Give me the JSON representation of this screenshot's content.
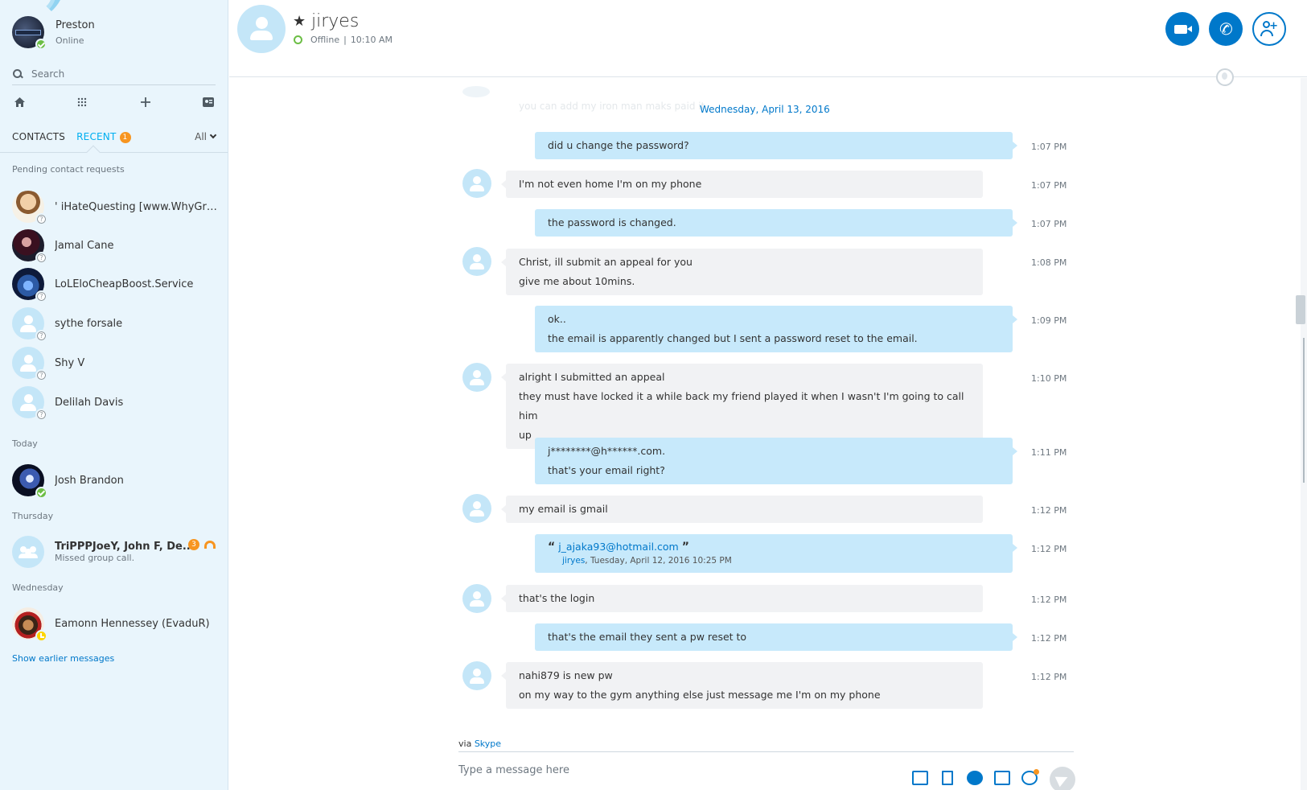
{
  "profile": {
    "name": "Preston",
    "status": "Online"
  },
  "search": {
    "placeholder": "Search"
  },
  "toolbar_icons": [
    "home-icon",
    "dialpad-icon",
    "plus-icon",
    "contacts-icon"
  ],
  "tabs": {
    "contacts": "CONTACTS",
    "recent": "RECENT",
    "recent_badge": "1",
    "filter": "All"
  },
  "sections": {
    "pending": "Pending contact requests",
    "today": "Today",
    "thursday": "Thursday",
    "wednesday": "Wednesday"
  },
  "pending_contacts": [
    {
      "name": "'    iHateQuesting [www.WhyGrin..."
    },
    {
      "name": "Jamal Cane"
    },
    {
      "name": "LoLEloCheapBoost.Service"
    },
    {
      "name": "sythe forsale"
    },
    {
      "name": "Shy V"
    },
    {
      "name": "Delilah Davis"
    }
  ],
  "today_contacts": [
    {
      "name": "Josh Brandon"
    }
  ],
  "thursday_contacts": [
    {
      "name": "TriPPPJoeY, John F, De...",
      "sub": "Missed group call.",
      "badge": "3"
    }
  ],
  "wednesday_contacts": [
    {
      "name": "Eamonn Hennessey (EvaduR)"
    }
  ],
  "show_earlier": "Show earlier messages",
  "conversation": {
    "name": "jiryes",
    "status": "Offline",
    "last_seen": "10:10 AM",
    "separator": "|"
  },
  "chat": {
    "faded_text": "you can add my iron man maks paid it",
    "date": "Wednesday, April 13, 2016",
    "messages": [
      {
        "from": "me",
        "lines": [
          "did u change the password?"
        ],
        "time": "1:07 PM"
      },
      {
        "from": "them",
        "lines": [
          "I'm not even home I'm on my phone"
        ],
        "time": "1:07 PM"
      },
      {
        "from": "me",
        "lines": [
          "the password is changed."
        ],
        "time": "1:07 PM"
      },
      {
        "from": "them",
        "lines": [
          "Christ, ill submit an appeal for you",
          "give me about 10mins."
        ],
        "time": "1:08 PM"
      },
      {
        "from": "me",
        "lines": [
          "ok..",
          "the email is apparently changed but I sent a password reset to the email."
        ],
        "time": "1:09 PM"
      },
      {
        "from": "them",
        "lines": [
          "alright I submitted an appeal",
          "they must have locked it a while back my friend played it when I wasn't I'm going to call him",
          "up"
        ],
        "time": "1:10 PM"
      },
      {
        "from": "me",
        "lines": [
          "j********@h******.com.",
          "that's your email right?"
        ],
        "time": "1:11 PM"
      },
      {
        "from": "them",
        "lines": [
          "my email is gmail"
        ],
        "time": "1:12 PM"
      },
      {
        "from": "me",
        "quote": {
          "text": "j_ajaka93@hotmail.com",
          "author": "jiryes",
          "date": ", Tuesday, April 12, 2016 10:25 PM"
        },
        "time": "1:12 PM"
      },
      {
        "from": "them",
        "lines": [
          "that's the login"
        ],
        "time": "1:12 PM"
      },
      {
        "from": "me",
        "lines": [
          "that's the email they sent a pw reset to"
        ],
        "time": "1:12 PM"
      },
      {
        "from": "them",
        "lines": [
          "nahi879 is new pw",
          "on my way to the gym anything else just message me I'm on my phone"
        ],
        "time": "1:12 PM"
      }
    ]
  },
  "compose": {
    "via_prefix": "via",
    "via_link": "Skype",
    "placeholder": "Type a message here"
  },
  "quote_marks": {
    "open": "“",
    "close": "”"
  }
}
